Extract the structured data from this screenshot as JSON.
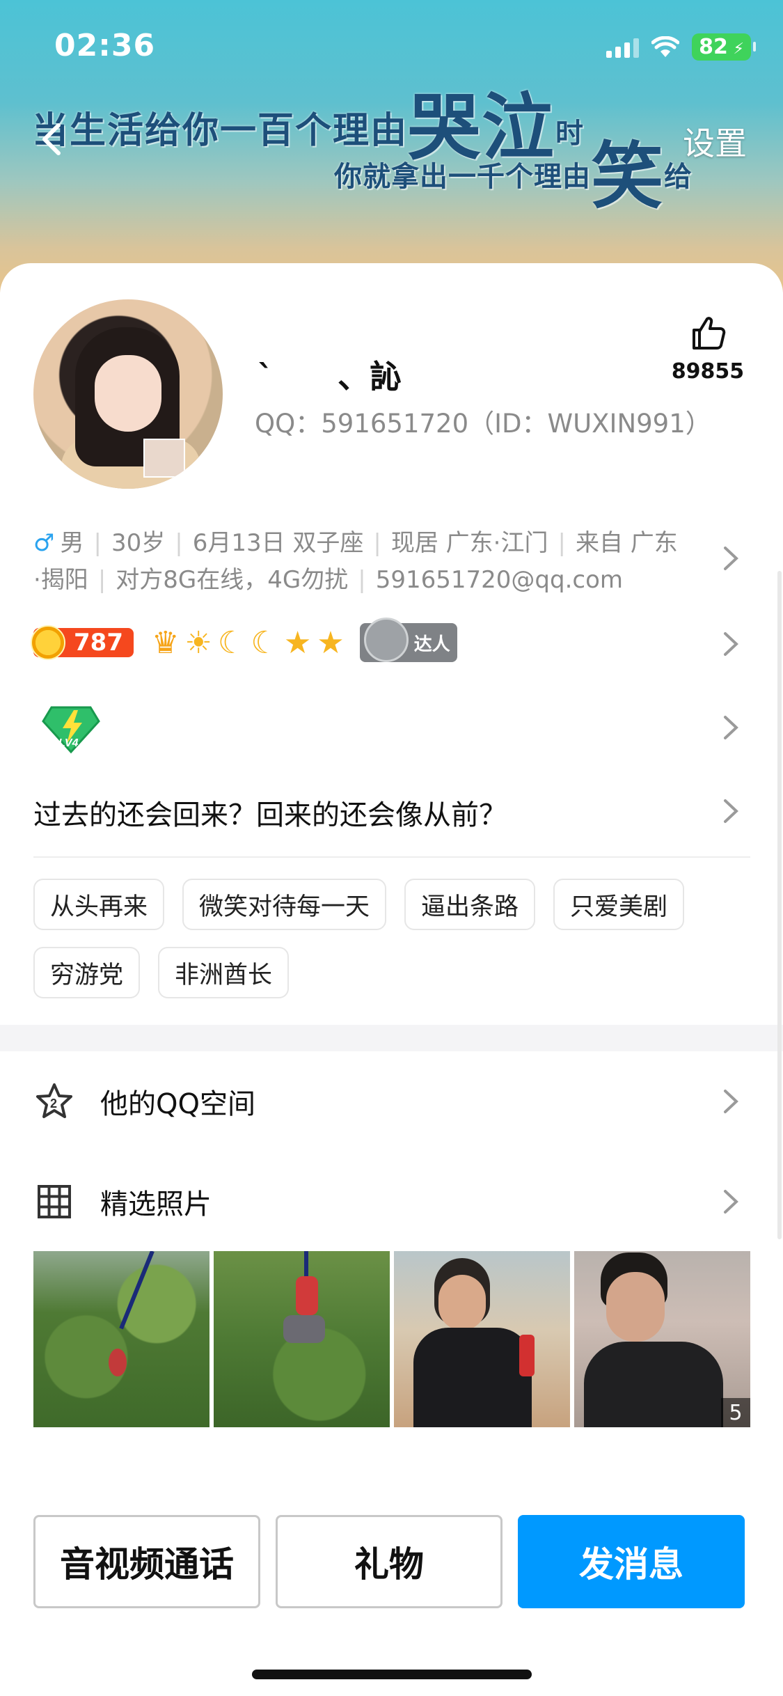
{
  "status_bar": {
    "time": "02:36",
    "battery": "82"
  },
  "cover": {
    "line1_a": "当生活给你一百个理由",
    "line1_big": "哭泣",
    "line1_b": "时",
    "line2_a": "你就拿出一千个理由",
    "line2_big": "笑",
    "line2_b": "给"
  },
  "header": {
    "settings_label": "设置"
  },
  "profile": {
    "nickname": "`　　、訫",
    "qq_line": "QQ：591651720（ID：WUXIN991）",
    "like_count": "89855",
    "gender_symbol": "♂",
    "info_line1": [
      "男",
      "30岁",
      "6月13日 双子座",
      "现居 广东·江门",
      "来自 广东"
    ],
    "info_line2": [
      "·揭阳",
      "对方8G在线，4G勿扰",
      "591651720@qq.com"
    ],
    "level": "787",
    "angel_badge_label": "达人",
    "vip_label": "LV4",
    "signature": "过去的还会回来？回来的还会像从前？",
    "tags": [
      "从头再来",
      "微笑对待每一天",
      "逼出条路",
      "只爱美剧",
      "穷游党",
      "非洲酋长"
    ]
  },
  "menu": {
    "qzone_label": "他的QQ空间",
    "qzone_badge": "2",
    "photos_label": "精选照片"
  },
  "photos": {
    "count": "5"
  },
  "actions": {
    "call_label": "音视频通话",
    "gift_label": "礼物",
    "message_label": "发消息"
  },
  "colors": {
    "primary": "#0099ff",
    "level_badge": "#f5481e",
    "male": "#2aa3ef"
  }
}
